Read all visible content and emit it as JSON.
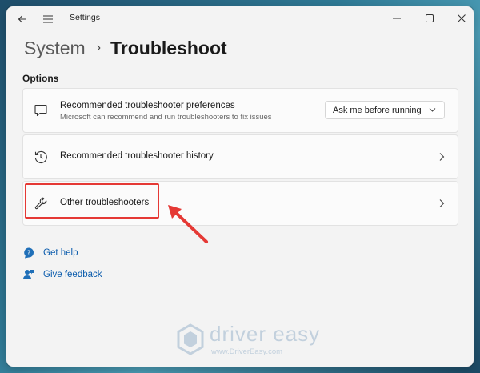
{
  "window": {
    "title": "Settings"
  },
  "header": {
    "parent": "System",
    "separator": "›",
    "current": "Troubleshoot"
  },
  "section": {
    "label": "Options"
  },
  "cards": [
    {
      "title": "Recommended troubleshooter preferences",
      "subtitle": "Microsoft can recommend and run troubleshooters to fix issues",
      "icon": "chat-bubble-icon",
      "dropdown_value": "Ask me before running"
    },
    {
      "title": "Recommended troubleshooter history",
      "icon": "history-icon"
    },
    {
      "title": "Other troubleshooters",
      "icon": "wrench-icon",
      "highlighted": true
    }
  ],
  "links": {
    "help": "Get help",
    "feedback": "Give feedback"
  },
  "watermark": {
    "brand": "driver easy",
    "url": "www.DriverEasy.com"
  },
  "colors": {
    "accent_link": "#0b5cad",
    "annotation": "#e53935",
    "window_bg": "#f3f3f3"
  }
}
